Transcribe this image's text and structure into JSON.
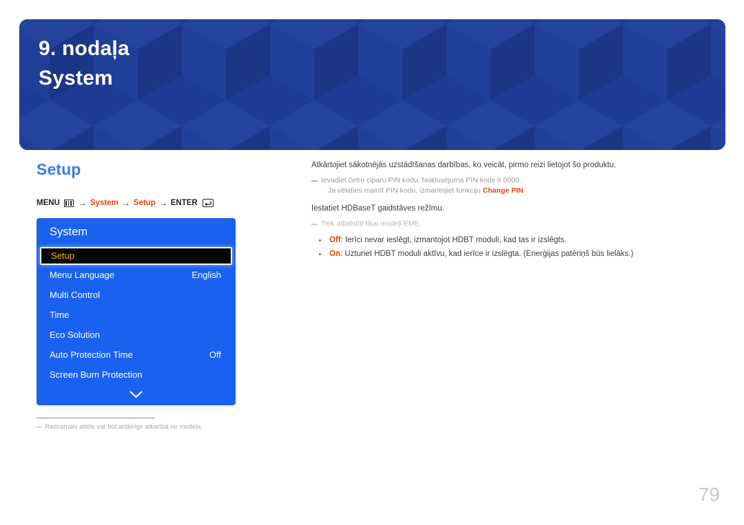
{
  "banner": {
    "chapter_number": "9. nodaļa",
    "chapter_title": "System",
    "bg_color": "#1e3c96"
  },
  "section": {
    "heading": "Setup",
    "heading_color": "#3b7ddd"
  },
  "menu_path": {
    "menu_label": "MENU",
    "menu_icon": "menu-icon",
    "arrow": "→",
    "step1": "System",
    "step2": "Setup",
    "enter_label": "ENTER",
    "enter_icon": "enter-icon",
    "accent_color": "#e8420f"
  },
  "osd": {
    "title": "System",
    "bg_color": "#1a61f0",
    "selected_text_color": "#f0b323",
    "chevron_icon": "chevron-down-icon",
    "rows": [
      {
        "label": "Setup",
        "value": "",
        "selected": true
      },
      {
        "label": "Menu Language",
        "value": "English",
        "selected": false
      },
      {
        "label": "Multi Control",
        "value": "",
        "selected": false
      },
      {
        "label": "Time",
        "value": "",
        "selected": false
      },
      {
        "label": "Eco Solution",
        "value": "",
        "selected": false
      },
      {
        "label": "Auto Protection Time",
        "value": "Off",
        "selected": false
      },
      {
        "label": "Screen Burn Protection",
        "value": "",
        "selected": false
      }
    ]
  },
  "left_footnote": {
    "text": "Redzamais attēls var būt atšķirīgs atkarībā no modeļa."
  },
  "content": {
    "para1": "Atkārtojiet sākotnējās uzstādīšanas darbības, ko veicāt, pirmo reizi lietojot šo produktu.",
    "note1_line1": "Ievadiet četru ciparu PIN kodu. Noklusējuma PIN kods ir 0000.",
    "note1_line2_pre": "Ja vēlaties mainīt PIN kodu, izmantojiet funkciju ",
    "note1_line2_accent": "Change PIN",
    "note1_line2_post": ".",
    "para2": "Iestatiet HDBaseT gaidstāves režīmu.",
    "note2": "Tiek atbalstīti tikai modeļi EME.",
    "bullets": [
      {
        "option": "Off",
        "separator": ": ",
        "text": "Ierīci nevar ieslēgt, izmantojot HDBT moduli, kad tas ir izslēgts."
      },
      {
        "option": "On",
        "separator": ": ",
        "text": "Uzturiet HDBT moduli aktīvu, kad ierīce ir izslēgta. (Enerģijas patēriņš būs lielāks.)"
      }
    ]
  },
  "page_number": "79"
}
